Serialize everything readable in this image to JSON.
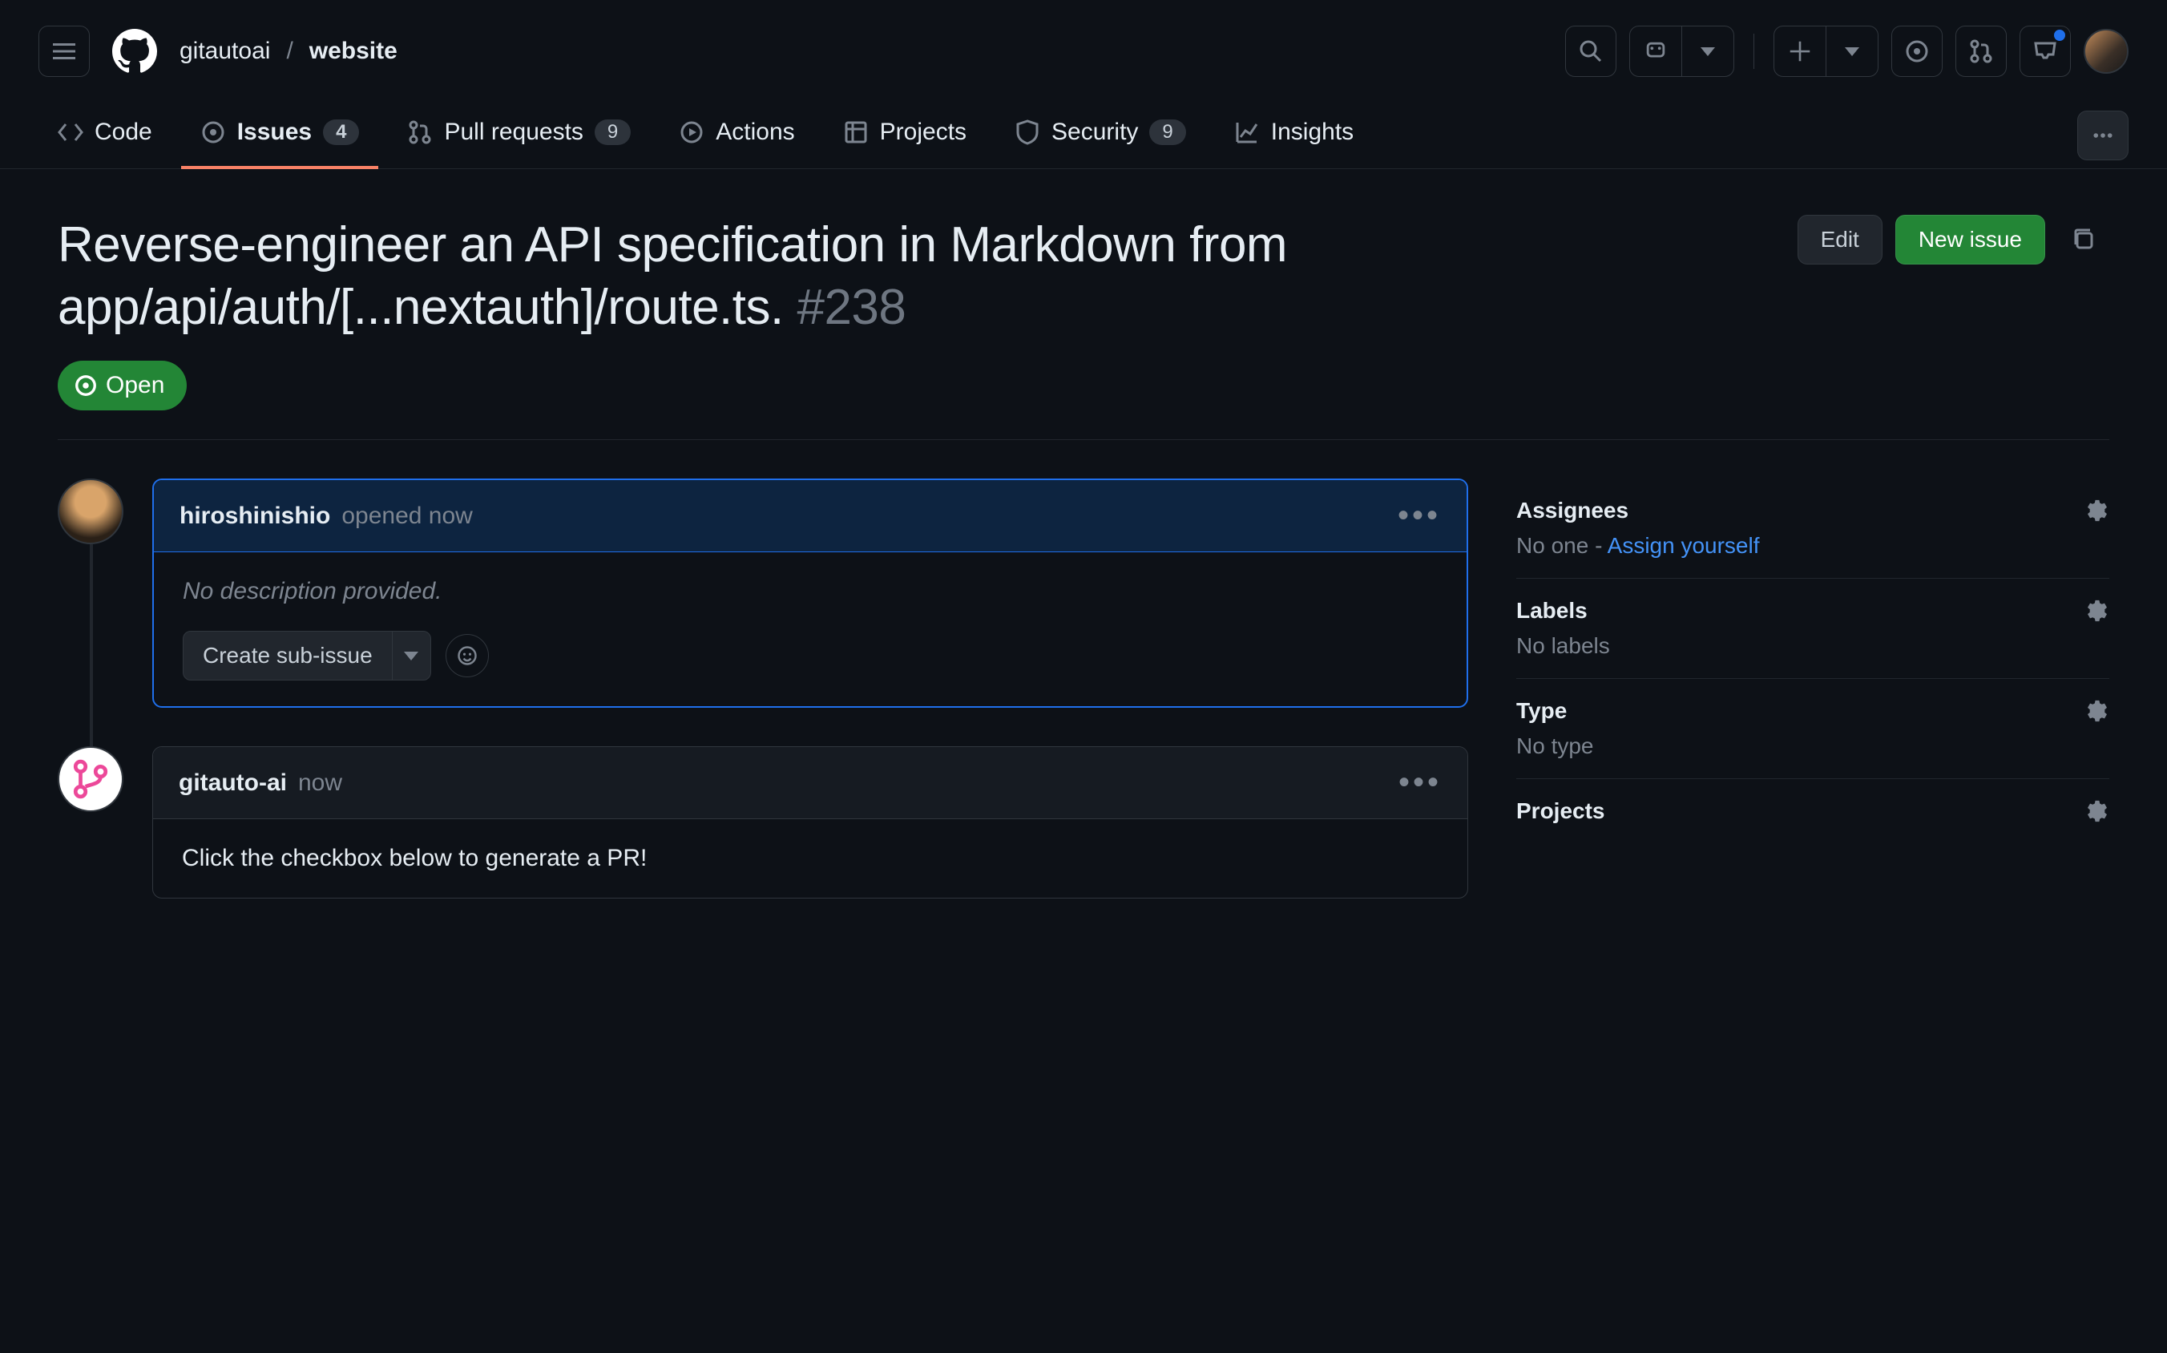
{
  "breadcrumb": {
    "owner": "gitautoai",
    "repo": "website"
  },
  "nav": {
    "code": "Code",
    "issues": "Issues",
    "issues_count": "4",
    "prs": "Pull requests",
    "prs_count": "9",
    "actions": "Actions",
    "projects": "Projects",
    "security": "Security",
    "security_count": "9",
    "insights": "Insights"
  },
  "issue": {
    "title": "Reverse-engineer an API specification in Markdown from app/api/auth/[...nextauth]/route.ts.",
    "number": "#238",
    "state": "Open",
    "edit": "Edit",
    "new_issue": "New issue"
  },
  "comments": [
    {
      "author": "hiroshinishio",
      "meta": "opened now",
      "body": "No description provided.",
      "is_owner": true,
      "show_foot": true,
      "create_sub": "Create sub-issue"
    },
    {
      "author": "gitauto-ai",
      "meta": "now",
      "body": "Click the checkbox below to generate a PR!",
      "is_owner": false,
      "show_foot": false
    }
  ],
  "sidebar": {
    "assignees": {
      "title": "Assignees",
      "text": "No one - ",
      "link": "Assign yourself"
    },
    "labels": {
      "title": "Labels",
      "text": "No labels"
    },
    "type": {
      "title": "Type",
      "text": "No type"
    },
    "projects": {
      "title": "Projects"
    }
  }
}
